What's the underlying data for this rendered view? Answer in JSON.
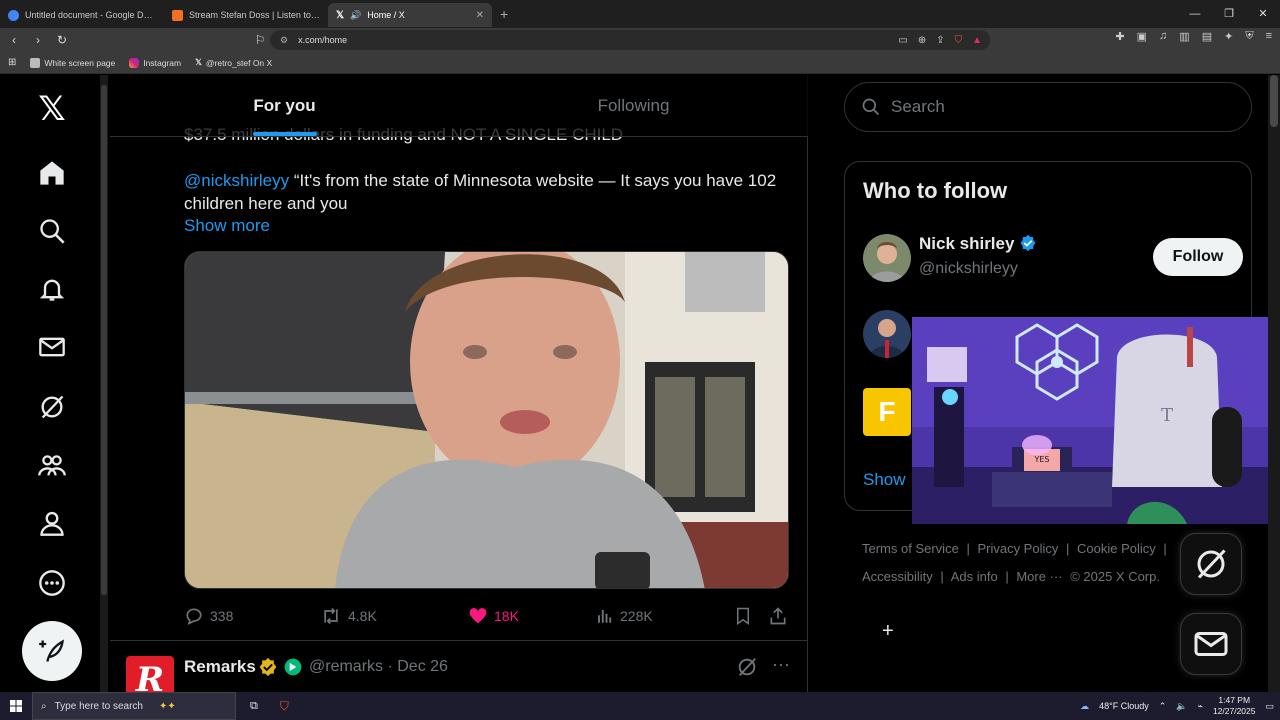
{
  "browser": {
    "tabs": [
      {
        "title": "Untitled document - Google Docs",
        "color": "#4285f4"
      },
      {
        "title": "Stream Stefan Doss | Listen to Decen",
        "color": "#f26f23"
      },
      {
        "title": "Home / X",
        "color": "#ffffff",
        "active": true
      }
    ],
    "url": "x.com/home",
    "bookmarks": [
      "White screen page",
      "Instagram",
      "@retro_stef On X"
    ]
  },
  "feed": {
    "tabs": [
      "For you",
      "Following"
    ],
    "active_tab": "For you",
    "cut_line": "$37.5 million dollars in funding and NOT A SINGLE CHILD",
    "tweet_mention": "@nickshirleyy",
    "tweet_text": " “It's from the state of Minnesota website — It says you have 102 children here and you",
    "show_more": "Show more",
    "actions": {
      "replies": "338",
      "reposts": "4.8K",
      "likes": "18K",
      "views": "228K"
    },
    "next_post": {
      "name": "Remarks",
      "handle": "@remarks · Dec 26",
      "avatar_letter": "R"
    }
  },
  "sidebar": {
    "search_placeholder": "Search",
    "who_to_follow_title": "Who to follow",
    "people": [
      {
        "name": "Nick shirley",
        "handle": "@nickshirleyy",
        "button": "Follow"
      }
    ],
    "show_more": "Show",
    "footer": [
      "Terms of Service",
      "|",
      "Privacy Policy",
      "|",
      "Cookie Policy",
      "|",
      "Accessibility",
      "|",
      "Ads info",
      "|",
      "More ···",
      "© 2025 X Corp."
    ]
  },
  "taskbar": {
    "search_placeholder": "Type here to search",
    "weather": "48°F  Cloudy",
    "time": "1:47 PM",
    "date": "12/27/2025"
  },
  "colors": {
    "accent": "#1d9bf0",
    "like": "#f91880",
    "background": "#000000"
  }
}
